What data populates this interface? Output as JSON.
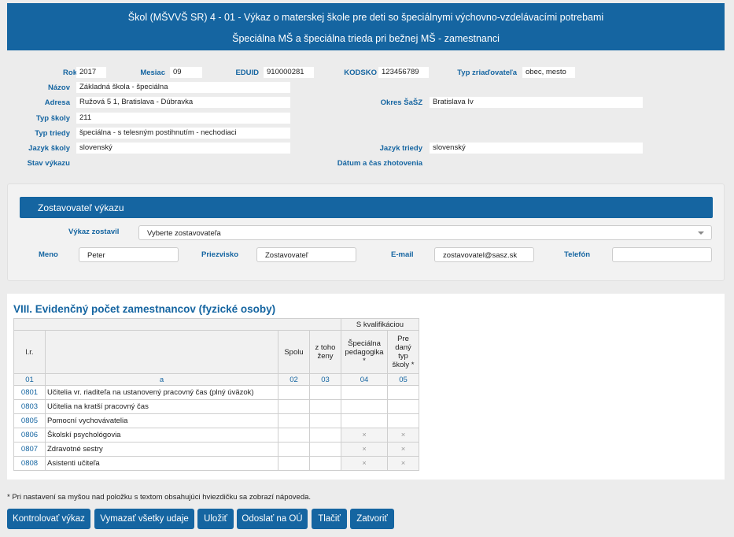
{
  "header": {
    "line1": "Škol (MŠVVŠ SR) 4 - 01 - Výkaz o materskej škole pre deti so špeciálnymi výchovno-vzdelávacími potrebami",
    "line2": "Špeciálna MŠ a špeciálna trieda pri bežnej MŠ - zamestnanci"
  },
  "info": {
    "rok_label": "Rok",
    "rok": "2017",
    "mesiac_label": "Mesiac",
    "mesiac": "09",
    "eduid_label": "EDUID",
    "eduid": "910000281",
    "kodsko_label": "KODSKO",
    "kodsko": "123456789",
    "typ_zriad_label": "Typ zriaďovateľa",
    "typ_zriad": "obec, mesto",
    "nazov_label": "Názov",
    "nazov": "Základná škola - špeciálna",
    "adresa_label": "Adresa",
    "adresa": "Ružová 5 1, Bratislava - Dúbravka",
    "okres_label": "Okres ŠaŠZ",
    "okres": "Bratislava Iv",
    "typ_skoly_label": "Typ školy",
    "typ_skoly": "211",
    "typ_triedy_label": "Typ triedy",
    "typ_triedy": "špeciálna - s telesným postihnutím - nechodiaci",
    "jazyk_skoly_label": "Jazyk školy",
    "jazyk_skoly": "slovenský",
    "jazyk_triedy_label": "Jazyk triedy",
    "jazyk_triedy": "slovenský",
    "stav_label": "Stav výkazu",
    "datum_label": "Dátum a čas zhotovenia"
  },
  "zostavovatel": {
    "title": "Zostavovateľ výkazu",
    "vykaz_zostavil_label": "Výkaz zostavil",
    "vykaz_zostavil_value": "Vyberte zostavovateľa",
    "meno_label": "Meno",
    "meno": "Peter",
    "priezvisko_label": "Priezvisko",
    "priezvisko": "Zostavovateľ",
    "email_label": "E-mail",
    "email": "zostavovatel@sasz.sk",
    "telefon_label": "Telefón",
    "telefon": ""
  },
  "section": {
    "title": "VIII. Evidenčný počet zamestnancov (fyzické osoby)",
    "group_header": "S kvalifikáciou",
    "col_lr": "l.r.",
    "col_spolu": "Spolu",
    "col_zeny": "z toho ženy",
    "col_spec": "Špeciálna pedagogika *",
    "col_pre": "Pre daný typ školy *",
    "num_lr": "01",
    "num_a": "a",
    "num_02": "02",
    "num_03": "03",
    "num_04": "04",
    "num_05": "05",
    "rows": [
      {
        "code": "0801",
        "label": "Učitelia vr. riaditeľa na ustanovený pracovný čas (plný úväzok)",
        "c4": "",
        "c5": ""
      },
      {
        "code": "0803",
        "label": "Učitelia na kratší pracovný čas",
        "c4": "",
        "c5": ""
      },
      {
        "code": "0805",
        "label": "Pomocní vychovávatelia",
        "c4": "",
        "c5": ""
      },
      {
        "code": "0806",
        "label": "Školskí psychológovia",
        "c4": "×",
        "c5": "×"
      },
      {
        "code": "0807",
        "label": "Zdravotné sestry",
        "c4": "×",
        "c5": "×"
      },
      {
        "code": "0808",
        "label": "Asistenti učiteľa",
        "c4": "×",
        "c5": "×"
      }
    ]
  },
  "note": "* Pri nastavení sa myšou nad položku s textom obsahujúci hviezdičku sa zobrazí nápoveda.",
  "buttons": {
    "kontrolovat": "Kontrolovať výkaz",
    "vymazat": "Vymazať všetky udaje",
    "ulozit": "Uložiť",
    "odoslat": "Odoslať na OÚ",
    "tlacit": "Tlačiť",
    "zatvorit": "Zatvoriť"
  }
}
